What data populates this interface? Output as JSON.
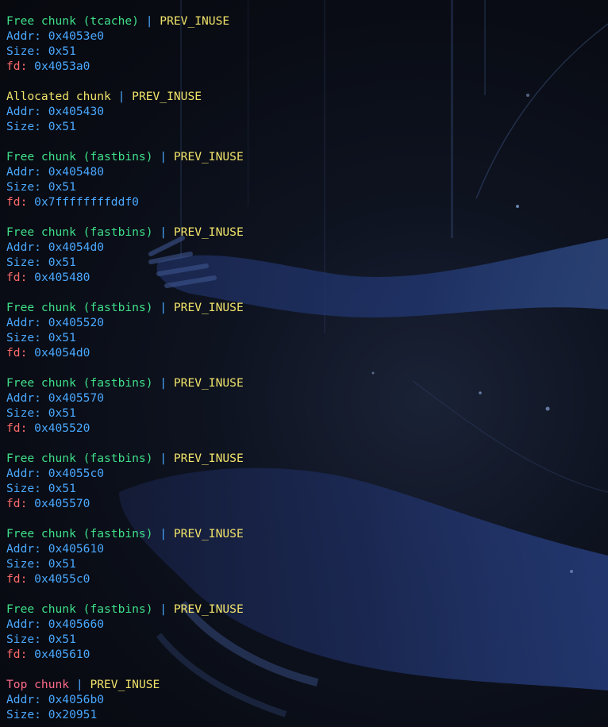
{
  "colors": {
    "free": "#3fe08a",
    "allocated": "#f0e26a",
    "top": "#ff6b8a",
    "separator": "#4aa8ff",
    "flag": "#f0e26a",
    "field_label": "#4aa8ff",
    "fd_label": "#ff6b6b",
    "value": "#4aa8ff"
  },
  "separator": " | ",
  "chunks": [
    {
      "kind": "free",
      "header": "Free chunk (tcache)",
      "flag": "PREV_INUSE",
      "fields": [
        {
          "label": "Addr",
          "value": "0x4053e0"
        },
        {
          "label": "Size",
          "value": "0x51"
        },
        {
          "label": "fd",
          "value": "0x4053a0"
        }
      ]
    },
    {
      "kind": "allocated",
      "header": "Allocated chunk",
      "flag": "PREV_INUSE",
      "fields": [
        {
          "label": "Addr",
          "value": "0x405430"
        },
        {
          "label": "Size",
          "value": "0x51"
        }
      ]
    },
    {
      "kind": "free",
      "header": "Free chunk (fastbins)",
      "flag": "PREV_INUSE",
      "fields": [
        {
          "label": "Addr",
          "value": "0x405480"
        },
        {
          "label": "Size",
          "value": "0x51"
        },
        {
          "label": "fd",
          "value": "0x7ffffffffddf0"
        }
      ]
    },
    {
      "kind": "free",
      "header": "Free chunk (fastbins)",
      "flag": "PREV_INUSE",
      "fields": [
        {
          "label": "Addr",
          "value": "0x4054d0"
        },
        {
          "label": "Size",
          "value": "0x51"
        },
        {
          "label": "fd",
          "value": "0x405480"
        }
      ]
    },
    {
      "kind": "free",
      "header": "Free chunk (fastbins)",
      "flag": "PREV_INUSE",
      "fields": [
        {
          "label": "Addr",
          "value": "0x405520"
        },
        {
          "label": "Size",
          "value": "0x51"
        },
        {
          "label": "fd",
          "value": "0x4054d0"
        }
      ]
    },
    {
      "kind": "free",
      "header": "Free chunk (fastbins)",
      "flag": "PREV_INUSE",
      "fields": [
        {
          "label": "Addr",
          "value": "0x405570"
        },
        {
          "label": "Size",
          "value": "0x51"
        },
        {
          "label": "fd",
          "value": "0x405520"
        }
      ]
    },
    {
      "kind": "free",
      "header": "Free chunk (fastbins)",
      "flag": "PREV_INUSE",
      "fields": [
        {
          "label": "Addr",
          "value": "0x4055c0"
        },
        {
          "label": "Size",
          "value": "0x51"
        },
        {
          "label": "fd",
          "value": "0x405570"
        }
      ]
    },
    {
      "kind": "free",
      "header": "Free chunk (fastbins)",
      "flag": "PREV_INUSE",
      "fields": [
        {
          "label": "Addr",
          "value": "0x405610"
        },
        {
          "label": "Size",
          "value": "0x51"
        },
        {
          "label": "fd",
          "value": "0x4055c0"
        }
      ]
    },
    {
      "kind": "free",
      "header": "Free chunk (fastbins)",
      "flag": "PREV_INUSE",
      "fields": [
        {
          "label": "Addr",
          "value": "0x405660"
        },
        {
          "label": "Size",
          "value": "0x51"
        },
        {
          "label": "fd",
          "value": "0x405610"
        }
      ]
    },
    {
      "kind": "top",
      "header": "Top chunk",
      "flag": "PREV_INUSE",
      "fields": [
        {
          "label": "Addr",
          "value": "0x4056b0"
        },
        {
          "label": "Size",
          "value": "0x20951"
        }
      ]
    }
  ]
}
